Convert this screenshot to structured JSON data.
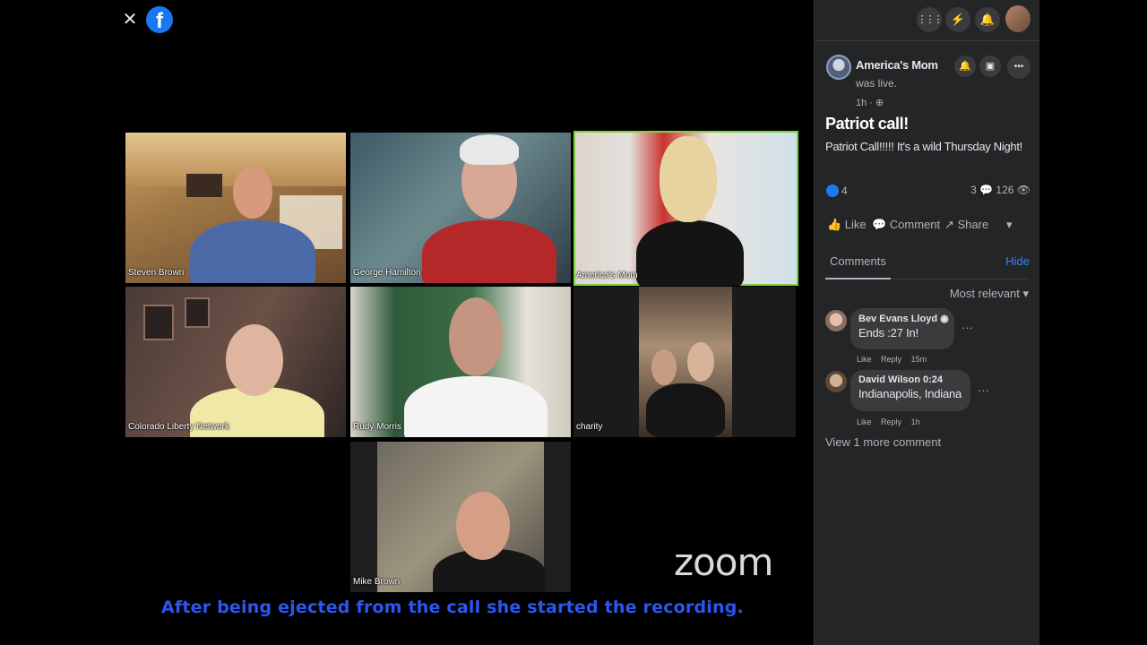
{
  "viewer": {
    "close_glyph": "✕",
    "logo_letter": "f",
    "zoom_logo": "zoom",
    "caption": "After being ejected from the call she started the recording."
  },
  "participants": [
    {
      "name": "Steven Brown"
    },
    {
      "name": "George Hamilton"
    },
    {
      "name": "America's Mom"
    },
    {
      "name": "Colorado Liberty Network"
    },
    {
      "name": "Rudy Morris"
    },
    {
      "name": "charity"
    },
    {
      "name": "Mike Brown"
    }
  ],
  "topnav": {
    "icons": [
      "grid-icon",
      "messenger-icon",
      "bell-icon",
      "profile-avatar"
    ],
    "menu_glyph": "⋮⋮⋮",
    "messenger_glyph": "⚡",
    "bell_glyph": "🔔"
  },
  "post": {
    "author": "America's Mom",
    "status": "was live.",
    "time": "1h · ⊕",
    "title": "Patriot call!",
    "text": "Patriot Call!!!!! It's a wild Thursday Night!",
    "reaction_count": "4",
    "stats": "3 💬  126 👁",
    "actions": {
      "like": "👍 Like",
      "comment": "💬 Comment",
      "share": "↗ Share",
      "more": "▾"
    },
    "header_buttons": {
      "bell": "🔔",
      "save": "▣",
      "more": "•••"
    }
  },
  "comments_section": {
    "tab": "Comments",
    "hide": "Hide",
    "sort": "Most relevant ▾",
    "items": [
      {
        "author": "Bev Evans Lloyd ◉",
        "text": "Ends :27 In!",
        "like": "Like",
        "reply": "Reply",
        "time": "15m"
      },
      {
        "author": "David Wilson  0:24",
        "text": "Indianapolis, Indiana",
        "like": "Like",
        "reply": "Reply",
        "time": "1h"
      }
    ],
    "view_more": "View 1 more comment",
    "more_glyph": "···"
  }
}
